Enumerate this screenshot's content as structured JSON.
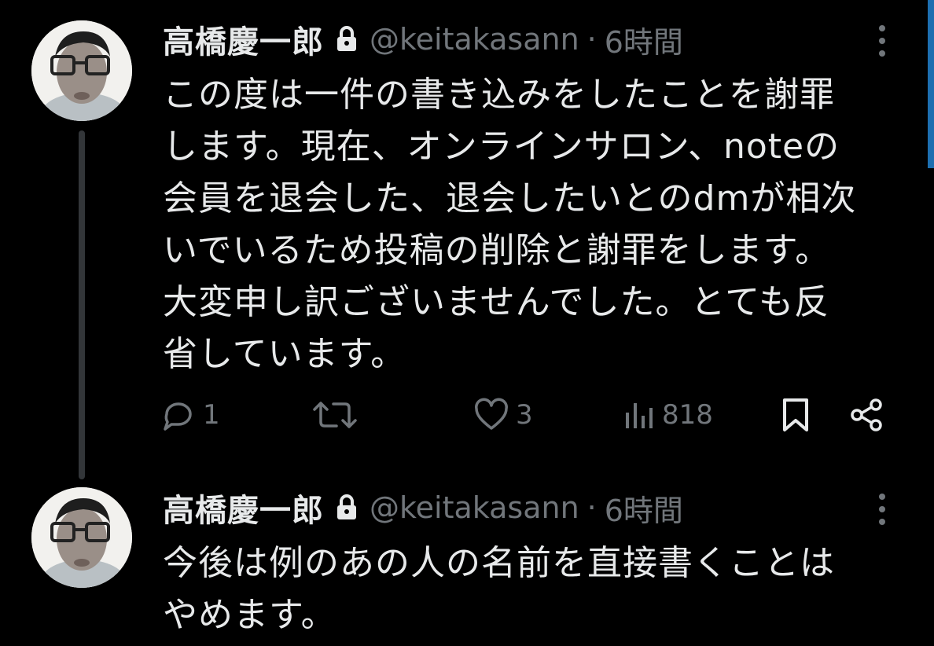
{
  "tweets": [
    {
      "author": {
        "display_name": "高橋慶一郎",
        "handle": "@keitakasann",
        "protected_icon": "lock-icon"
      },
      "separator": "·",
      "timestamp": "6時間",
      "text": "この度は一件の書き込みをしたことを謝罪\nします。現在、オンラインサロン、noteの\n会員を退会した、退会したいとのdmが相次\nいでいるため投稿の削除と謝罪をします。\n大変申し訳ございませんでした。とても反\n省しています。",
      "actions": {
        "reply": {
          "icon": "reply-icon",
          "count": "1"
        },
        "retweet": {
          "icon": "retweet-icon",
          "count": ""
        },
        "like": {
          "icon": "heart-icon",
          "count": "3"
        },
        "views": {
          "icon": "views-icon",
          "count": "818"
        },
        "bookmark": {
          "icon": "bookmark-icon"
        },
        "share": {
          "icon": "share-icon"
        }
      }
    },
    {
      "author": {
        "display_name": "高橋慶一郎",
        "handle": "@keitakasann",
        "protected_icon": "lock-icon"
      },
      "separator": "·",
      "timestamp": "6時間",
      "text": "今後は例のあの人の名前を直接書くことは\nやめます。"
    }
  ],
  "colors": {
    "background": "#000000",
    "primary_text": "#e7e9ea",
    "secondary_text": "#71767b",
    "thread_line": "#333639",
    "scroll_indicator": "#1d6fb0"
  }
}
